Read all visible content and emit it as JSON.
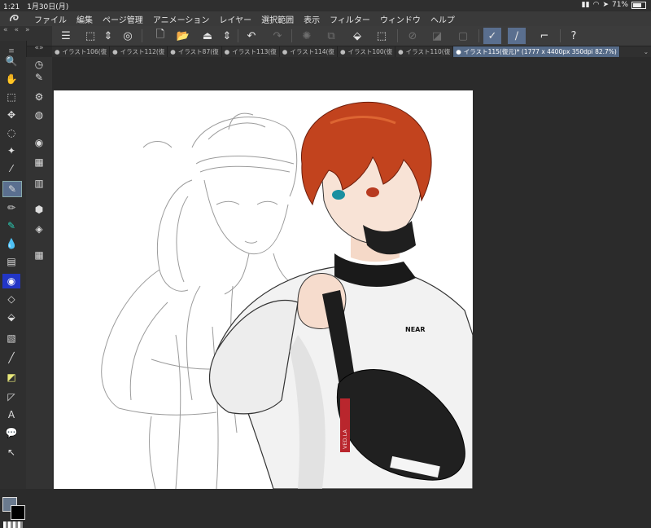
{
  "status": {
    "time": "1:21",
    "date": "1月30日(月)",
    "battery": "71%"
  },
  "menu": [
    "ファイル",
    "編集",
    "ページ管理",
    "アニメーション",
    "レイヤー",
    "選択範囲",
    "表示",
    "フィルター",
    "ウィンドウ",
    "ヘルプ"
  ],
  "tabs": [
    {
      "label": "イラスト106(復",
      "active": false
    },
    {
      "label": "イラスト112(復",
      "active": false
    },
    {
      "label": "イラスト87(復",
      "active": false
    },
    {
      "label": "イラスト113(復",
      "active": false
    },
    {
      "label": "イラスト114(復",
      "active": false
    },
    {
      "label": "イラスト100(復",
      "active": false
    },
    {
      "label": "イラスト110(復",
      "active": false
    },
    {
      "label": "イラスト115(復元)* (1777 x 4400px 350dpi 82.7%)",
      "active": true
    }
  ],
  "canvas_text": {
    "shirt_logo": "NEAR",
    "strap_text": "VED.LA"
  },
  "colors": {
    "accent": "#5a6f8f",
    "toolbar": "#3c3c3c",
    "canvas": "#ffffff",
    "hair": "#c2431e"
  }
}
